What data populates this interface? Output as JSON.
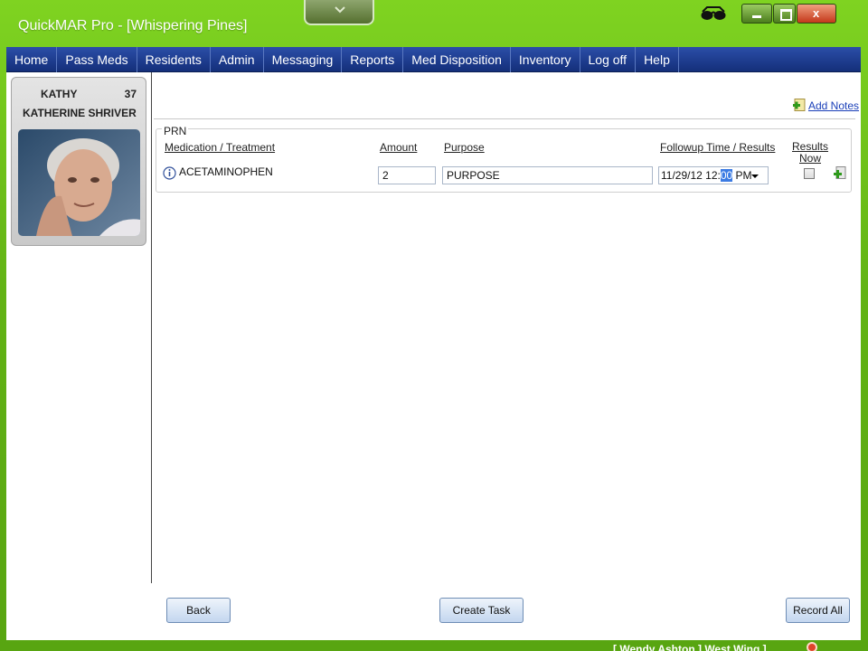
{
  "window": {
    "title": "QuickMAR Pro - [Whispering Pines]"
  },
  "menu": {
    "items": [
      "Home",
      "Pass Meds",
      "Residents",
      "Admin",
      "Messaging",
      "Reports",
      "Med Disposition",
      "Inventory",
      "Log off",
      "Help"
    ]
  },
  "resident": {
    "first_name": "KATHY",
    "number": "37",
    "full_name": "KATHERINE SHRIVER"
  },
  "add_notes_label": "Add Notes",
  "prn": {
    "legend": "PRN",
    "headers": {
      "medication": "Medication / Treatment",
      "amount": "Amount",
      "purpose": "Purpose",
      "followup": "Followup Time / Results",
      "results_now_1": "Results",
      "results_now_2": "Now"
    },
    "row": {
      "medication": "ACETAMINOPHEN",
      "amount": "2",
      "purpose": "PURPOSE",
      "followup_date": "11/29/12 12:",
      "followup_min": "00",
      "followup_ampm": " PM",
      "results_now_checked": false
    }
  },
  "buttons": {
    "back": "Back",
    "create_task": "Create Task",
    "record_all": "Record All"
  },
  "status_bar": {
    "text": "[ Wendy Ashton ] West Wing ]"
  },
  "icons": {
    "info": "info-icon",
    "add_notes": "add-notes-icon",
    "row_add": "add-icon",
    "glasses": "glasses-icon"
  },
  "colors": {
    "frame_green": "#62b315",
    "menu_blue": "#1d3c8f",
    "link_blue": "#1a3fb8"
  }
}
